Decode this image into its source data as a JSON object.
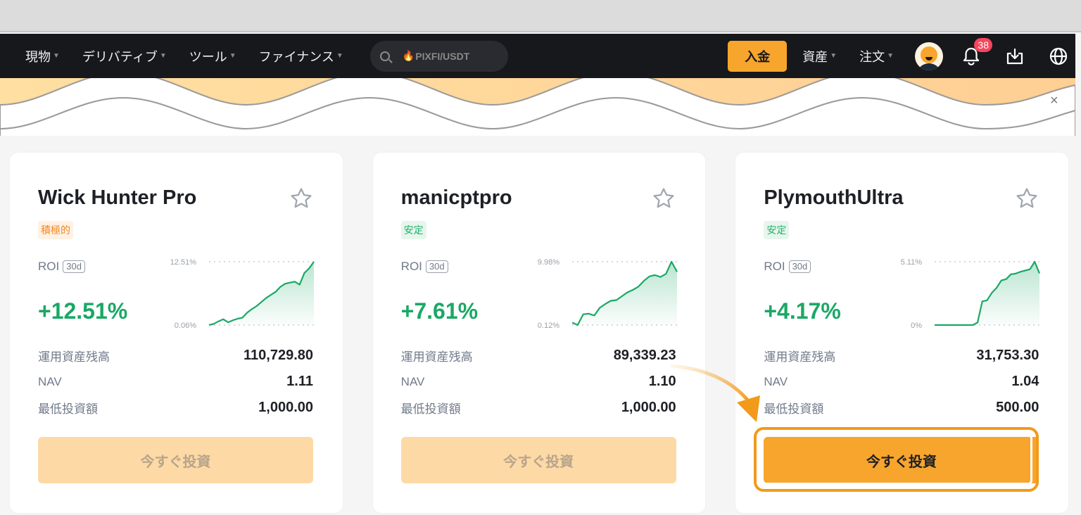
{
  "nav": {
    "items": [
      {
        "label": "現物"
      },
      {
        "label": "デリバティブ"
      },
      {
        "label": "ツール"
      },
      {
        "label": "ファイナンス"
      }
    ],
    "search_placeholder": "PIXFI/USDT",
    "deposit_label": "入金",
    "assets_label": "資産",
    "orders_label": "注文",
    "notification_count": "38"
  },
  "banner": {
    "close_glyph": "×"
  },
  "colors": {
    "accent": "#f7a52c",
    "positive": "#1aa866",
    "nav_bg": "#17181c"
  },
  "cards": [
    {
      "title": "Wick Hunter Pro",
      "tag": "積極的",
      "tag_type": "aggressive",
      "roi_label": "ROI",
      "period": "30d",
      "roi_value": "+12.51%",
      "chart_max_label": "12.51%",
      "chart_min_label": "0.06%",
      "aum_label": "運用資産残高",
      "aum_value": "110,729.80",
      "nav_label": "NAV",
      "nav_value": "1.11",
      "min_label": "最低投資額",
      "min_value": "1,000.00",
      "button_label": "今すぐ投資",
      "button_state": "disabled"
    },
    {
      "title": "manicptpro",
      "tag": "安定",
      "tag_type": "stable",
      "roi_label": "ROI",
      "period": "30d",
      "roi_value": "+7.61%",
      "chart_max_label": "9.98%",
      "chart_min_label": "0.12%",
      "aum_label": "運用資産残高",
      "aum_value": "89,339.23",
      "nav_label": "NAV",
      "nav_value": "1.10",
      "min_label": "最低投資額",
      "min_value": "1,000.00",
      "button_label": "今すぐ投資",
      "button_state": "disabled"
    },
    {
      "title": "PlymouthUltra",
      "tag": "安定",
      "tag_type": "stable",
      "roi_label": "ROI",
      "period": "30d",
      "roi_value": "+4.17%",
      "chart_max_label": "5.11%",
      "chart_min_label": "0%",
      "aum_label": "運用資産残高",
      "aum_value": "31,753.30",
      "nav_label": "NAV",
      "nav_value": "1.04",
      "min_label": "最低投資額",
      "min_value": "500.00",
      "button_label": "今すぐ投資",
      "button_state": "active"
    }
  ],
  "chart_data": [
    {
      "type": "area",
      "title": "Wick Hunter Pro ROI 30d",
      "ylim": [
        0.06,
        12.51
      ],
      "y_tick_labels": [
        "12.51%",
        "0.06%"
      ],
      "values": [
        0.06,
        0.3,
        0.8,
        1.2,
        0.6,
        1.0,
        1.3,
        1.5,
        2.5,
        3.2,
        3.8,
        4.6,
        5.4,
        6.0,
        6.6,
        7.6,
        8.2,
        8.4,
        8.6,
        8.0,
        10.3,
        11.2,
        12.51
      ]
    },
    {
      "type": "area",
      "title": "manicptpro ROI 30d",
      "ylim": [
        0.12,
        9.98
      ],
      "y_tick_labels": [
        "9.98%",
        "0.12%"
      ],
      "values": [
        0.5,
        0.12,
        1.8,
        1.9,
        1.6,
        2.8,
        3.4,
        3.9,
        4.0,
        4.6,
        5.2,
        5.6,
        6.1,
        7.0,
        7.7,
        7.9,
        7.6,
        8.1,
        9.98,
        8.4
      ]
    },
    {
      "type": "area",
      "title": "PlymouthUltra ROI 30d",
      "ylim": [
        0,
        5.11
      ],
      "y_tick_labels": [
        "5.11%",
        "0%"
      ],
      "values": [
        0,
        0,
        0,
        0,
        0,
        0,
        0,
        0,
        0,
        0.2,
        1.9,
        2.0,
        2.6,
        3.0,
        3.6,
        3.7,
        4.1,
        4.15,
        4.3,
        4.4,
        4.5,
        5.11,
        4.17
      ]
    }
  ]
}
